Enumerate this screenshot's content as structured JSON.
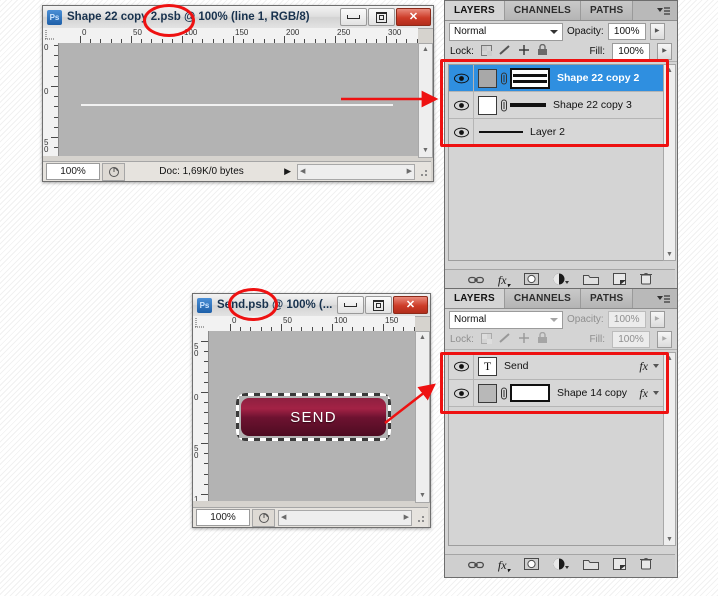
{
  "windows": [
    {
      "id": "win-shape22",
      "title": "Shape 22 copy 2.psb @ 100% (line 1, RGB/8)",
      "logo": "Ps",
      "zoom": "100%",
      "doc_info": "Doc: 1,69K/0 bytes",
      "ruler_h": [
        "0",
        "50",
        "100",
        "150",
        "200",
        "250",
        "300"
      ],
      "ruler_v": [
        "50",
        "0",
        "50"
      ],
      "controls": {
        "minimize": "minimize-icon",
        "maximize": "maximize-icon",
        "close": "close-icon"
      }
    },
    {
      "id": "win-send",
      "title": "Send.psb @ 100% (...",
      "logo": "Ps",
      "zoom": "100%",
      "doc_info": "",
      "ruler_h": [
        "0",
        "50",
        "100",
        "150"
      ],
      "ruler_v": [
        "50",
        "0",
        "50",
        "1"
      ],
      "button_label": "SEND",
      "controls": {
        "minimize": "minimize-icon",
        "maximize": "maximize-icon",
        "close": "close-icon"
      }
    }
  ],
  "panels": [
    {
      "id": "layers-panel-top",
      "tabs": [
        "LAYERS",
        "CHANNELS",
        "PATHS"
      ],
      "active_tab": "LAYERS",
      "blend_mode": "Normal",
      "opacity_label": "Opacity:",
      "opacity_value": "100%",
      "lock_label": "Lock:",
      "fill_label": "Fill:",
      "fill_value": "100%",
      "enabled": true,
      "lock_icons": [
        "lock-transparent-icon",
        "lock-image-icon",
        "lock-position-icon",
        "lock-all-icon"
      ],
      "layers": [
        {
          "name": "Shape 22 copy 2",
          "selected": true,
          "visible": true,
          "thumb": "#a8a8a8",
          "has_link": true,
          "has_mask": true,
          "mask_style": "double-bar",
          "has_fx": false
        },
        {
          "name": "Shape 22 copy 3",
          "selected": false,
          "visible": true,
          "thumb": "#ffffff",
          "has_link": true,
          "has_mask": true,
          "mask_style": "single-bar",
          "has_fx": false
        },
        {
          "name": "Layer 2",
          "selected": false,
          "visible": true,
          "thumb": null,
          "has_link": false,
          "has_mask": true,
          "mask_style": "thin-bar",
          "has_fx": false
        }
      ],
      "bottom_icons": [
        "link-icon",
        "fx-icon",
        "add-mask-icon",
        "adjustment-layer-icon",
        "new-group-icon",
        "new-layer-icon",
        "delete-layer-icon"
      ]
    },
    {
      "id": "layers-panel-bottom",
      "tabs": [
        "LAYERS",
        "CHANNELS",
        "PATHS"
      ],
      "active_tab": "LAYERS",
      "blend_mode": "Normal",
      "opacity_label": "Opacity:",
      "opacity_value": "100%",
      "lock_label": "Lock:",
      "fill_label": "Fill:",
      "fill_value": "100%",
      "enabled": false,
      "lock_icons": [
        "lock-transparent-icon",
        "lock-image-icon",
        "lock-position-icon",
        "lock-all-icon"
      ],
      "layers": [
        {
          "name": "Send",
          "selected": false,
          "visible": true,
          "thumb": "text",
          "has_link": false,
          "has_mask": false,
          "has_fx": true
        },
        {
          "name": "Shape 14 copy",
          "selected": false,
          "visible": true,
          "thumb": "#b8b8b8",
          "has_link": true,
          "has_mask": true,
          "mask_style": "box-bar",
          "has_fx": true
        }
      ],
      "bottom_icons": [
        "link-icon",
        "fx-icon",
        "add-mask-icon",
        "adjustment-layer-icon",
        "new-group-icon",
        "new-layer-icon",
        "delete-layer-icon"
      ]
    }
  ],
  "annotations": {
    "accent_color": "#ee1111",
    "marks": [
      {
        "name": "ellipse-highlight-psb-top",
        "kind": "ellipse"
      },
      {
        "name": "ellipse-highlight-psb-bottom",
        "kind": "ellipse"
      },
      {
        "name": "red-box-layers-top",
        "kind": "box"
      },
      {
        "name": "red-box-layers-bottom",
        "kind": "box"
      },
      {
        "name": "arrow-canvas-to-layers-top",
        "kind": "arrow"
      },
      {
        "name": "arrow-send-to-layers-bottom",
        "kind": "arrow"
      }
    ]
  }
}
